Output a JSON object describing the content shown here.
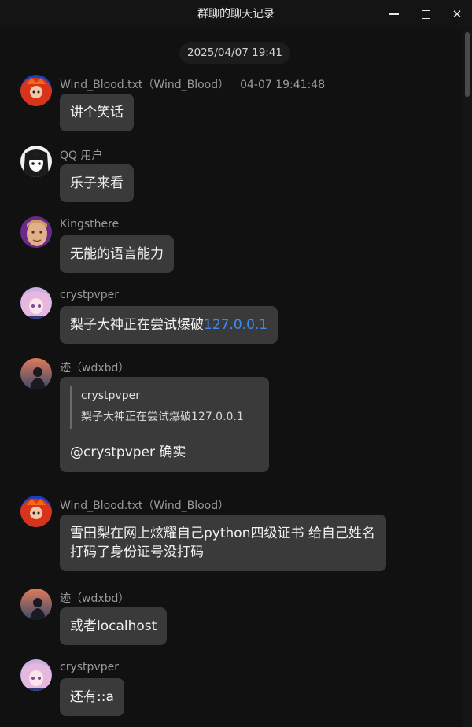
{
  "window": {
    "title": "群聊的聊天记录",
    "minimize_icon": "minimize-icon",
    "maximize_icon": "maximize-icon",
    "close_icon": "close-icon",
    "close_glyph": "✕"
  },
  "chat": {
    "time_divider": "2025/04/07 19:41",
    "messages": [
      {
        "sender": "Wind_Blood.txt（Wind_Blood）",
        "timestamp": "04-07 19:41:48",
        "text": "讲个笑话",
        "avatar": {
          "icon": "avatar-red-hair",
          "colors": [
            "#1d3fbf",
            "#d8341c",
            "#f06a1c"
          ]
        }
      },
      {
        "sender": "QQ 用户",
        "text": "乐子来看",
        "avatar": {
          "icon": "avatar-manga-girl",
          "colors": [
            "#f2f2f2",
            "#1b1b1b"
          ]
        }
      },
      {
        "sender": "Kingsthere",
        "text": "无能的语言能力",
        "avatar": {
          "icon": "avatar-photo-face",
          "colors": [
            "#6a2a8a",
            "#e0b08a"
          ]
        }
      },
      {
        "sender": "crystpvper",
        "text": "梨子大神正在尝试爆破",
        "link": "127.0.0.1",
        "avatar": {
          "icon": "avatar-pink-anime",
          "colors": [
            "#e6b8e0",
            "#7a4aa0"
          ]
        }
      },
      {
        "sender": "迹（wdxbd）",
        "quote_sender": "crystpvper",
        "quote_text": "梨子大神正在尝试爆破127.0.0.1",
        "text": "@crystpvper 确实",
        "avatar": {
          "icon": "avatar-sunset-figure",
          "colors": [
            "#e07a5a",
            "#3a4a6a"
          ]
        }
      },
      {
        "sender": "Wind_Blood.txt（Wind_Blood）",
        "text": "雪田梨在网上炫耀自己python四级证书 给自己姓名打码了身份证号没打码",
        "avatar": {
          "icon": "avatar-red-hair",
          "colors": [
            "#1d3fbf",
            "#d8341c",
            "#f06a1c"
          ]
        }
      },
      {
        "sender": "迹（wdxbd）",
        "text": "或者localhost",
        "avatar": {
          "icon": "avatar-sunset-figure",
          "colors": [
            "#e07a5a",
            "#3a4a6a"
          ]
        }
      },
      {
        "sender": "crystpvper",
        "text": "还有::a",
        "avatar": {
          "icon": "avatar-pink-anime",
          "colors": [
            "#e6b8e0",
            "#7a4aa0"
          ]
        }
      }
    ]
  }
}
